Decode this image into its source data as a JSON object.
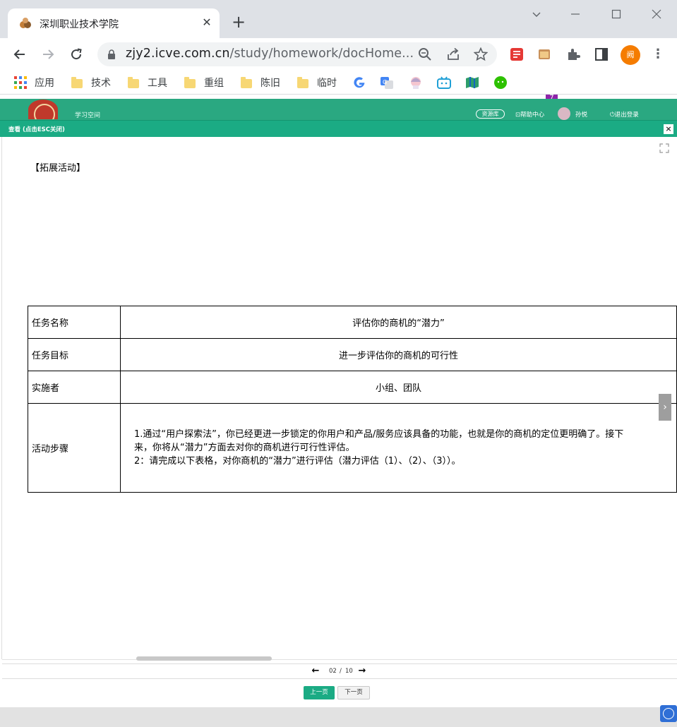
{
  "browser": {
    "tab_title": "深圳职业技术学院",
    "url_host": "zjy2.icve.com.cn",
    "url_path": "/study/homework/docHome...",
    "extension_badge": "7",
    "profile_initial": "阙"
  },
  "bookmarks": [
    {
      "label": "应用",
      "icon": "apps-grid-icon"
    },
    {
      "label": "技术",
      "icon": "folder-icon"
    },
    {
      "label": "工具",
      "icon": "folder-icon"
    },
    {
      "label": "重组",
      "icon": "folder-icon"
    },
    {
      "label": "陈旧",
      "icon": "folder-icon"
    },
    {
      "label": "临时",
      "icon": "folder-icon"
    }
  ],
  "site": {
    "study_space": "学习空间",
    "resource_btn": "资源库",
    "help_center": "帮助中心",
    "user_name": "孙悦",
    "logout": "退出登录",
    "brand_color": "#2aa881"
  },
  "modal": {
    "title": "查看 (点击ESC关闭)",
    "heading": "【拓展活动】",
    "rows": [
      {
        "label": "任务名称",
        "value": "评估你的商机的“潜力”"
      },
      {
        "label": "任务目标",
        "value": "进一步评估你的商机的可行性"
      },
      {
        "label": "实施者",
        "value": "小组、团队"
      }
    ],
    "steps_label": "活动步骤",
    "steps_line1": "1.通过“用户探索法”，你已经更进一步锁定的你用户和产品/服务应该具备的功能，也就是你的商机的定位更明确了。接下来，你将从“潜力”方面去对你的商机进行可行性评估。",
    "steps_line2": "2：请完成以下表格，对你商机的“潜力”进行评估（潜力评估（1）、（2）、（3））。",
    "current_page": "02",
    "page_sep": "/",
    "total_pages": "10",
    "prev_button": "上一页",
    "next_button": "下一页"
  }
}
